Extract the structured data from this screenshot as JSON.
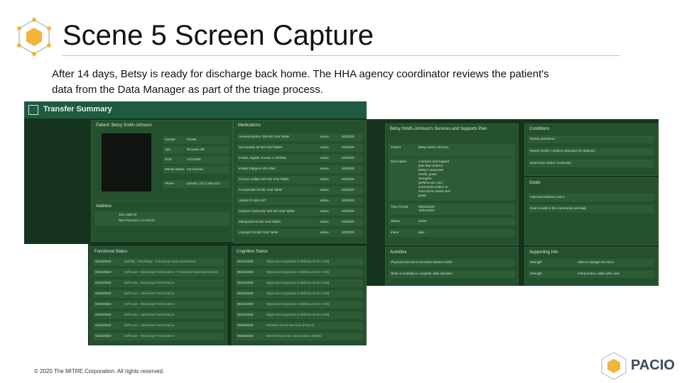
{
  "slide": {
    "title": "Scene 5 Screen Capture",
    "description": "After 14 days, Betsy is ready for discharge back home. The HHA agency coordinator reviews the patient's data from the Data Manager as part of the triage process.",
    "copyright": "© 2020 The MITRE Corporation. All rights reserved.",
    "brand": "PACIO"
  },
  "app": {
    "header_title": "Transfer Summary",
    "patient": {
      "heading": "Patient: Betsy Smith-Johnson",
      "fields": [
        {
          "label": "Gender",
          "value": "female"
        },
        {
          "label": "Age",
          "value": "65 years old"
        },
        {
          "label": "DOB",
          "value": "11/1/1952"
        },
        {
          "label": "Marital Status",
          "value": "not married"
        },
        {
          "label": "Phone",
          "value": "primary: (317) 555-1111"
        }
      ],
      "address_heading": "Address",
      "address_line1": "1111 Main St",
      "address_line2": "San Francisco, CA 94110"
    },
    "medications": {
      "heading": "Medications",
      "rows": [
        {
          "name": "Acetaminophen 325 MG Oral Tablet",
          "status": "active",
          "date": "3/3/2020"
        },
        {
          "name": "Simvastatin 20 MG Oral Tablet",
          "status": "active",
          "date": "3/3/2020"
        },
        {
          "name": "Insulin, regular, human 1 UNT/ML",
          "status": "active",
          "date": "3/3/2020"
        },
        {
          "name": "Insulin Glargine 100 U/ML",
          "status": "active",
          "date": "3/3/2020"
        },
        {
          "name": "Ferrous sulfate 325 MG Oral Tablet",
          "status": "active",
          "date": "3/3/2020"
        },
        {
          "name": "Furosemide 20 MG Oral Tablet",
          "status": "active",
          "date": "3/3/2020"
        },
        {
          "name": "Vitamin D 400 UNT",
          "status": "active",
          "date": "3/3/2020"
        },
        {
          "name": "Calcium Carbonate 500 MG Oral Tablet",
          "status": "active",
          "date": "3/3/2020"
        },
        {
          "name": "Metoprolol 25 MG Oral Tablet",
          "status": "active",
          "date": "3/3/2020"
        },
        {
          "name": "Lisinopril 10 MG Oral Tablet",
          "status": "active",
          "date": "3/3/2020"
        }
      ]
    },
    "functional": {
      "heading": "Functional Status",
      "rows": [
        {
          "date": "05/13/2020",
          "text": "Mobility - Discharge - Functional Goal Assessment"
        },
        {
          "date": "05/13/2020",
          "text": "Self-Care - Discharge Performance - Functional Goal Assessment"
        },
        {
          "date": "04/23/2020",
          "text": "Self-Care - Discharge Performance"
        },
        {
          "date": "04/30/2020",
          "text": "Self-Care - Admission Performance"
        },
        {
          "date": "04/30/2020",
          "text": "Self-Care - Discharge Performance"
        },
        {
          "date": "04/30/2020",
          "text": "Self-Care - Admission Performance"
        },
        {
          "date": "04/23/2020",
          "text": "Self-Care - Admission Performance"
        },
        {
          "date": "04/23/2020",
          "text": "Self-Care - Discharge Performance"
        }
      ]
    },
    "cognitive": {
      "heading": "Cognitive Status",
      "rows": [
        {
          "date": "05/13/2020",
          "text": "Signs and symptoms of delirium (from CAM)"
        },
        {
          "date": "05/13/2020",
          "text": "Signs and symptoms of delirium (from CAM)"
        },
        {
          "date": "05/13/2020",
          "text": "Signs and symptoms of delirium (from CAM)"
        },
        {
          "date": "05/13/2020",
          "text": "Signs and symptoms of delirium (from CAM)"
        },
        {
          "date": "05/13/2020",
          "text": "Signs and symptoms of delirium (from CAM)"
        },
        {
          "date": "05/13/2020",
          "text": "Signs and symptoms of delirium (from CAM)"
        },
        {
          "date": "05/05/2020",
          "text": "Resident mood interview (PHQ-9)"
        },
        {
          "date": "05/05/2020",
          "text": "Brief interview for mental status (BIMS)"
        }
      ]
    },
    "plan": {
      "heading": "Betsy Smith-Johnson's Services and Supports Plan",
      "fields": [
        {
          "label": "Patient",
          "value": "Betsy Smith-Johnson"
        },
        {
          "label": "Description",
          "value": "A service and support plan that outlines Betsy's assessed needs, goals, strengths, preferences, and services/providers to meet those needs and goals."
        },
        {
          "label": "Time Period",
          "value": "05/01/2020 - 11/01/2020"
        },
        {
          "label": "Status",
          "value": "active"
        },
        {
          "label": "Intent",
          "value": "plan"
        }
      ]
    },
    "conditions": {
      "heading": "Conditions",
      "rows": [
        "Needs assistance",
        "Needs health / nutrition education for diabetes",
        "Depression (mild / moderate)"
      ]
    },
    "goals": {
      "heading": "Goals",
      "rows": [
        "Improved balance and s...",
        "Goal to walk in the community and daily"
      ]
    },
    "activities": {
      "heading": "Activities",
      "rows": [
        "Physical exercise to increase balance skills",
        "Work on mobility to complete daily activities"
      ]
    },
    "supporting": {
      "heading": "Supporting Info",
      "rows": [
        {
          "type": "Strength",
          "value": "Able to manage her ADLs"
        },
        {
          "type": "Strength",
          "value": "Independent, walks with cane"
        }
      ]
    }
  }
}
